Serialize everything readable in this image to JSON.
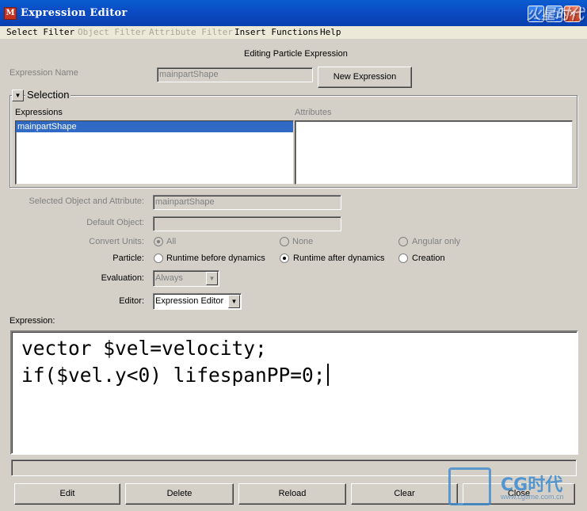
{
  "window": {
    "title": "Expression Editor",
    "app_icon_glyph": "M"
  },
  "menu": [
    {
      "label": "Select Filter",
      "enabled": true
    },
    {
      "label": "Object Filter",
      "enabled": false
    },
    {
      "label": "Attribute Filter",
      "enabled": false
    },
    {
      "label": "Insert Functions",
      "enabled": true
    },
    {
      "label": "Help",
      "enabled": true
    }
  ],
  "header": {
    "mode": "Editing Particle Expression",
    "name_label": "Expression Name",
    "name_value": "mainpartShape",
    "new_expression": "New Expression"
  },
  "selection": {
    "title": "Selection",
    "expressions_label": "Expressions",
    "attributes_label": "Attributes",
    "expressions": [
      "mainpartShape"
    ],
    "attributes": []
  },
  "details": {
    "selected_label": "Selected Object and Attribute:",
    "selected_value": "mainpartShape",
    "default_object_label": "Default Object:",
    "default_object_value": "",
    "convert_units": {
      "label": "Convert Units:",
      "options": [
        "All",
        "None",
        "Angular only"
      ],
      "selected": "All"
    },
    "particle": {
      "label": "Particle:",
      "options": [
        "Runtime before dynamics",
        "Runtime after dynamics",
        "Creation"
      ],
      "selected": "Runtime after dynamics"
    },
    "evaluation": {
      "label": "Evaluation:",
      "value": "Always"
    },
    "editor": {
      "label": "Editor:",
      "value": "Expression Editor"
    }
  },
  "expression": {
    "label": "Expression:",
    "lines": [
      "vector $vel=velocity;",
      "if($vel.y<0) lifespanPP=0;"
    ]
  },
  "buttons": {
    "edit": "Edit",
    "delete": "Delete",
    "reload": "Reload",
    "clear": "Clear",
    "close": "Close"
  },
  "watermarks": {
    "top": "火星时代",
    "brand": "CG时代",
    "url": "www.cgtime.com.cn"
  }
}
